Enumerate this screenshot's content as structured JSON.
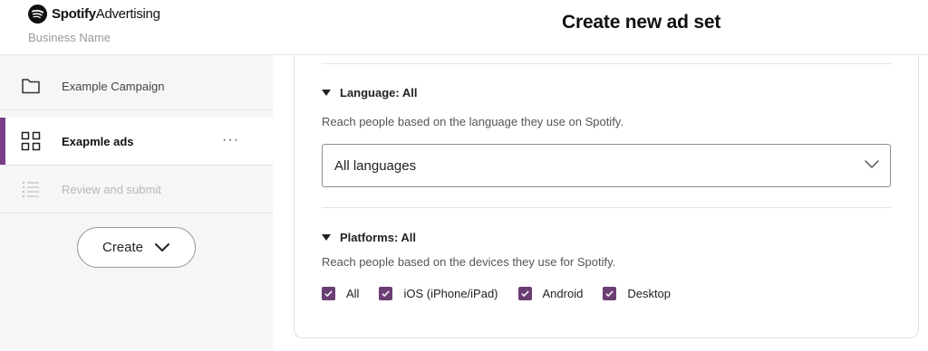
{
  "header": {
    "brand_name": "Spotify",
    "brand_suffix": "Advertising",
    "business_name": "Business Name",
    "page_title": "Create new ad set"
  },
  "sidebar": {
    "items": [
      {
        "label": "Example Campaign",
        "icon": "folder-icon",
        "state": "default"
      },
      {
        "label": "Exapmle ads",
        "icon": "grid-icon",
        "state": "active",
        "more": "···"
      },
      {
        "label": "Review and submit",
        "icon": "list-icon",
        "state": "disabled"
      }
    ],
    "create_label": "Create"
  },
  "language": {
    "title": "Language: All",
    "description": "Reach people based on the language they use on Spotify.",
    "select_value": "All languages"
  },
  "platforms": {
    "title": "Platforms: All",
    "description": "Reach people based on the devices they use for Spotify.",
    "options": [
      {
        "label": "All",
        "checked": true
      },
      {
        "label": "iOS (iPhone/iPad)",
        "checked": true
      },
      {
        "label": "Android",
        "checked": true
      },
      {
        "label": "Desktop",
        "checked": true
      }
    ]
  },
  "colors": {
    "accent": "#7a3e88",
    "checkbox": "#6b3e74"
  }
}
